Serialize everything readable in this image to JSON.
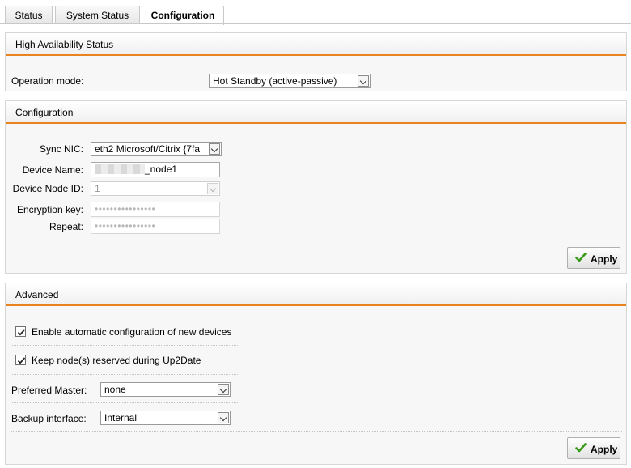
{
  "tabs": [
    {
      "label": "Status",
      "active": false
    },
    {
      "label": "System Status",
      "active": false
    },
    {
      "label": "Configuration",
      "active": true
    }
  ],
  "ha_status": {
    "title": "High Availability Status",
    "operation_mode_label": "Operation mode:",
    "operation_mode_value": "Hot Standby (active-passive)"
  },
  "configuration": {
    "title": "Configuration",
    "sync_nic_label": "Sync NIC:",
    "sync_nic_value": "eth2 Microsoft/Citrix {7fa",
    "device_name_label": "Device Name:",
    "device_name_suffix": "_node1",
    "device_node_id_label": "Device Node ID:",
    "device_node_id_value": "1",
    "encryption_key_label": "Encryption key:",
    "encryption_key_value": "••••••••••••••••",
    "repeat_label": "Repeat:",
    "repeat_value": "••••••••••••••••",
    "apply_label": "Apply"
  },
  "advanced": {
    "title": "Advanced",
    "auto_config_label": "Enable automatic configuration of new devices",
    "auto_config_checked": true,
    "keep_reserved_label": "Keep node(s) reserved during Up2Date",
    "keep_reserved_checked": true,
    "preferred_master_label": "Preferred Master:",
    "preferred_master_value": "none",
    "backup_interface_label": "Backup interface:",
    "backup_interface_value": "Internal",
    "apply_label": "Apply"
  },
  "colors": {
    "accent": "#e8841e",
    "check_green": "#3a9a1a"
  }
}
